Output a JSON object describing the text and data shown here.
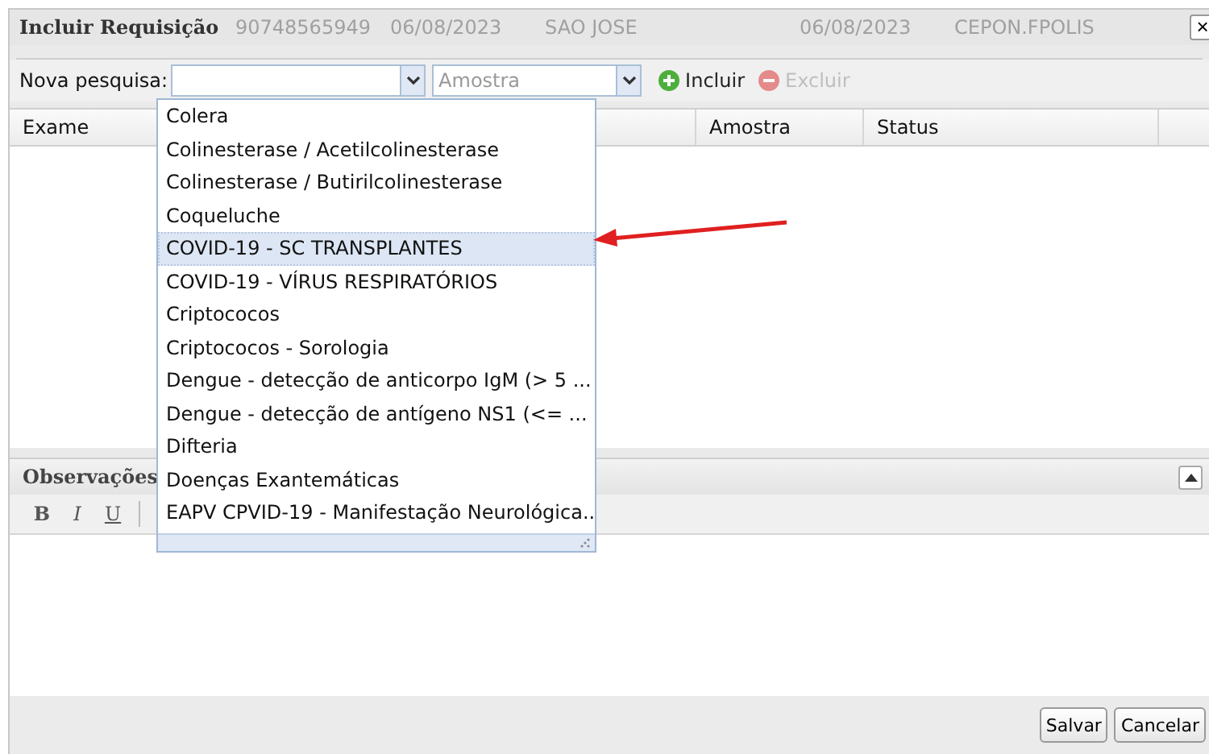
{
  "window": {
    "title": "Incluir Requisição",
    "close": "×"
  },
  "header_info": [
    "90748565949",
    "06/08/2023",
    "SAO JOSE",
    "06/08/2023",
    "CEPON.FPOLIS"
  ],
  "toolbar": {
    "search_label": "Nova pesquisa:",
    "sample_field": {
      "placeholder": "Amostra"
    },
    "actions": [
      {
        "label": "Incluir",
        "kind": "add",
        "disabled": false
      },
      {
        "label": "Excluir",
        "kind": "remove",
        "disabled": true
      }
    ]
  },
  "table": {
    "columns": [
      "Exame",
      "Amostra",
      "Status"
    ]
  },
  "dropdown": {
    "items": [
      {
        "label": "Colera",
        "selected": false
      },
      {
        "label": "Colinesterase / Acetilcolinesterase",
        "selected": false
      },
      {
        "label": "Colinesterase / Butirilcolinesterase",
        "selected": false
      },
      {
        "label": "Coqueluche",
        "selected": false
      },
      {
        "label": "COVID-19 - SC TRANSPLANTES",
        "selected": true
      },
      {
        "label": "COVID-19 - VÍRUS RESPIRATÓRIOS",
        "selected": false
      },
      {
        "label": "Criptococos",
        "selected": false
      },
      {
        "label": "Criptococos - Sorologia",
        "selected": false
      },
      {
        "label": "Dengue - detecção de anticorpo IgM (> 5 ...",
        "selected": false
      },
      {
        "label": "Dengue - detecção de antígeno NS1 (<= ...",
        "selected": false
      },
      {
        "label": "Difteria",
        "selected": false
      },
      {
        "label": "Doenças Exantemáticas",
        "selected": false
      },
      {
        "label": "EAPV CPVID-19 - Manifestação Neurológica...",
        "selected": false
      }
    ]
  },
  "observations": {
    "title": "Observações",
    "format_buttons": [
      "B",
      "I",
      "U"
    ]
  },
  "buttons": [
    "Salvar",
    "Cancelar"
  ]
}
